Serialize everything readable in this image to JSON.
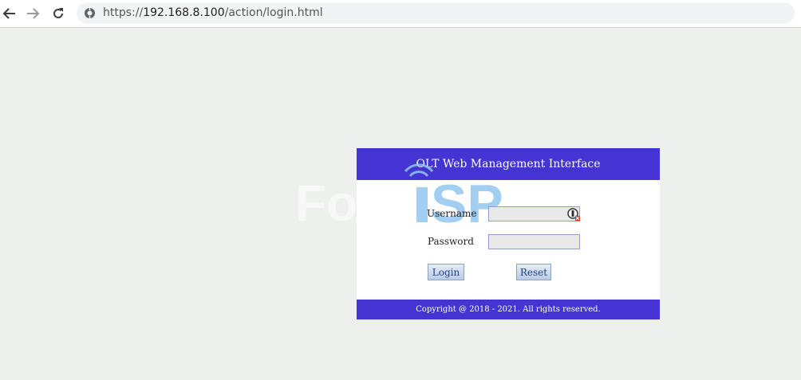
{
  "browser": {
    "url_prefix": "https://",
    "url_host": "192.168.8.100",
    "url_path": "/action/login.html",
    "icons": [
      "back-arrow-icon",
      "forward-arrow-icon",
      "reload-icon",
      "site-info-icon"
    ]
  },
  "watermark": {
    "text": "ForceISP"
  },
  "login": {
    "title": "OLT Web Management Interface",
    "username_label": "Username",
    "password_label": "Password",
    "username_value": "",
    "password_value": "",
    "login_button": "Login",
    "reset_button": "Reset",
    "copyright": "Copyright @ 2018 - 2021. All rights reserved."
  },
  "colors": {
    "header_bg": "#4435d3",
    "page_bg": "#eef0ed",
    "watermark_blue": "#90c6ee"
  }
}
